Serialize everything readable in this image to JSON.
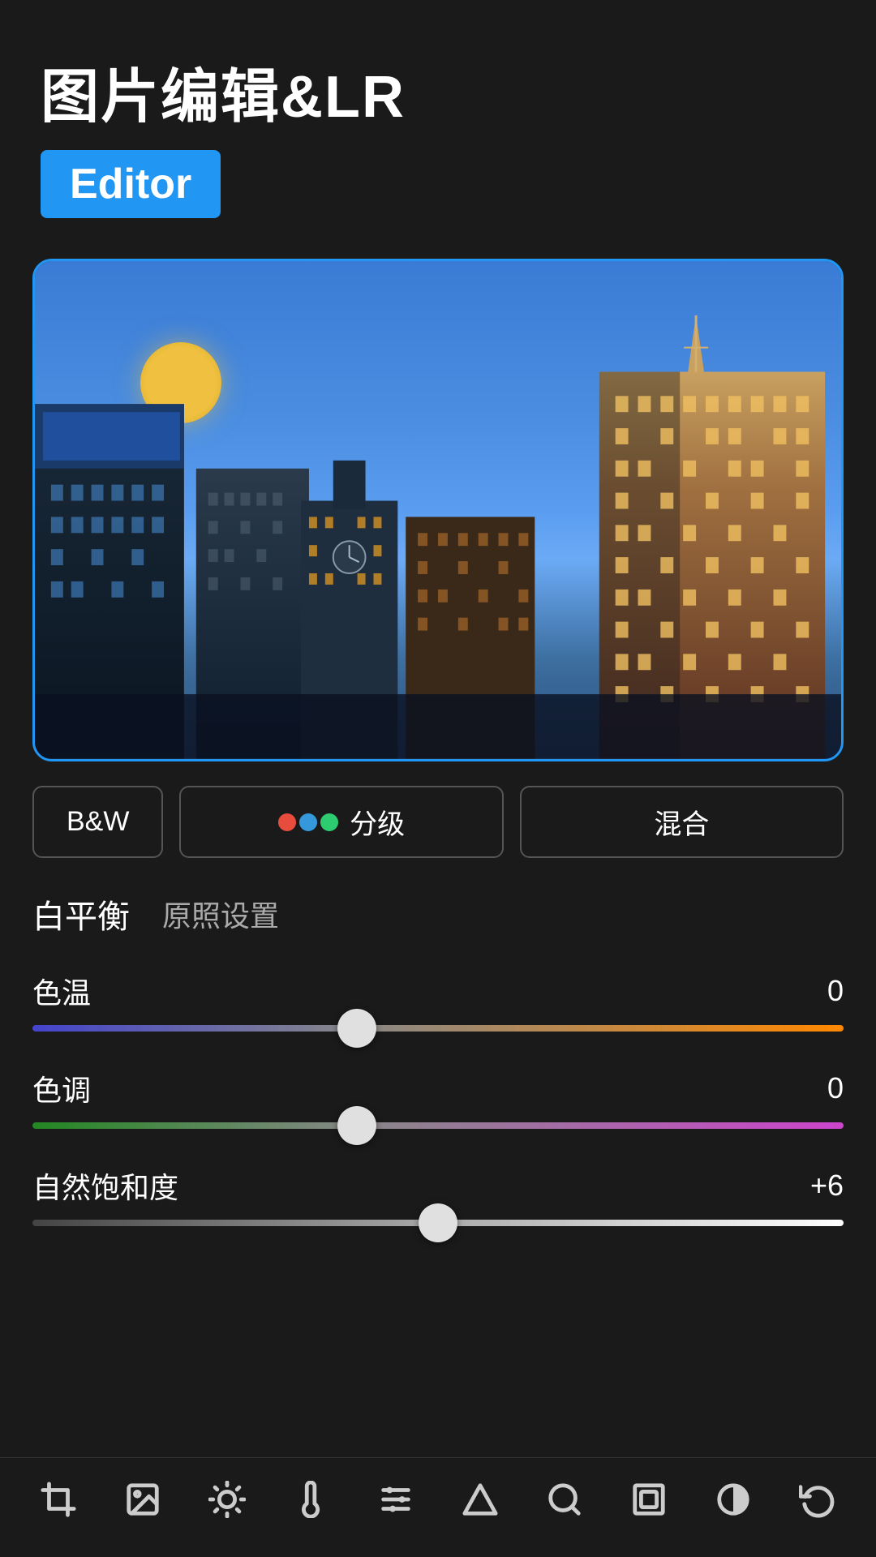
{
  "header": {
    "title": "图片编辑&LR",
    "badge": "Editor"
  },
  "tabs": [
    {
      "id": "bw",
      "label": "B&W"
    },
    {
      "id": "grading",
      "label": "分级"
    },
    {
      "id": "blend",
      "label": "混合"
    }
  ],
  "white_balance": {
    "label": "白平衡",
    "value": "原照设置"
  },
  "sliders": [
    {
      "id": "temp",
      "label": "色温",
      "value": "0",
      "percent": 40
    },
    {
      "id": "tint",
      "label": "色调",
      "value": "0",
      "percent": 40
    },
    {
      "id": "vibrance",
      "label": "自然饱和度",
      "value": "+6",
      "percent": 50
    }
  ],
  "toolbar": {
    "items": [
      {
        "id": "crop",
        "label": "裁剪"
      },
      {
        "id": "image",
        "label": "图像"
      },
      {
        "id": "light",
        "label": "光线"
      },
      {
        "id": "temp2",
        "label": "色温"
      },
      {
        "id": "adjust",
        "label": "调整"
      },
      {
        "id": "shape",
        "label": "形状"
      },
      {
        "id": "zoom",
        "label": "放大"
      },
      {
        "id": "frame",
        "label": "边框"
      },
      {
        "id": "circle",
        "label": "圆形"
      },
      {
        "id": "undo",
        "label": "撤销"
      }
    ]
  }
}
